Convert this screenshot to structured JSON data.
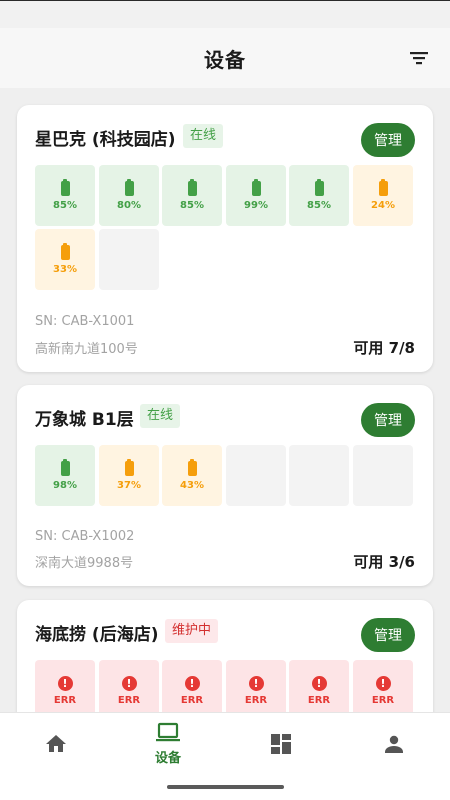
{
  "header": {
    "title": "设备",
    "filter_icon": "filter-icon"
  },
  "devices": [
    {
      "name": "星巴克 (科技园店)",
      "status": "在线",
      "manage_label": "管理",
      "slots": [
        {
          "state": "green",
          "label": "85%"
        },
        {
          "state": "green",
          "label": "80%"
        },
        {
          "state": "green",
          "label": "85%"
        },
        {
          "state": "green",
          "label": "99%"
        },
        {
          "state": "green",
          "label": "85%"
        },
        {
          "state": "amber",
          "label": "24%"
        },
        {
          "state": "amber",
          "label": "33%"
        },
        {
          "state": "empty",
          "label": ""
        }
      ],
      "sn": "SN: CAB-X1001",
      "address": "高新南九道100号",
      "available": "可用 7/8"
    },
    {
      "name": "万象城 B1层",
      "status": "在线",
      "manage_label": "管理",
      "slots": [
        {
          "state": "green",
          "label": "98%"
        },
        {
          "state": "amber",
          "label": "37%"
        },
        {
          "state": "amber",
          "label": "43%"
        },
        {
          "state": "empty",
          "label": ""
        },
        {
          "state": "empty",
          "label": ""
        },
        {
          "state": "empty",
          "label": ""
        }
      ],
      "sn": "SN: CAB-X1002",
      "address": "深南大道9988号",
      "available": "可用 3/6"
    },
    {
      "name": "海底捞 (后海店)",
      "status": "维护中",
      "manage_label": "管理",
      "slots": [
        {
          "state": "red",
          "label": "ERR"
        },
        {
          "state": "red",
          "label": "ERR"
        },
        {
          "state": "red",
          "label": "ERR"
        },
        {
          "state": "red",
          "label": "ERR"
        },
        {
          "state": "red",
          "label": "ERR"
        },
        {
          "state": "red",
          "label": "ERR"
        }
      ]
    }
  ],
  "tabs": [
    {
      "icon": "home-icon",
      "label": ""
    },
    {
      "icon": "laptop-icon",
      "label": "设备",
      "active": true
    },
    {
      "icon": "dashboard-icon",
      "label": ""
    },
    {
      "icon": "person-icon",
      "label": ""
    }
  ],
  "colors": {
    "primary": "#2e7d32",
    "green_slot": "#e5f3e6",
    "amber_slot": "#fff4e1",
    "red_slot": "#fde4e6",
    "online_badge": "#e7f4e8",
    "maintenance_badge": "#fde8ea"
  }
}
